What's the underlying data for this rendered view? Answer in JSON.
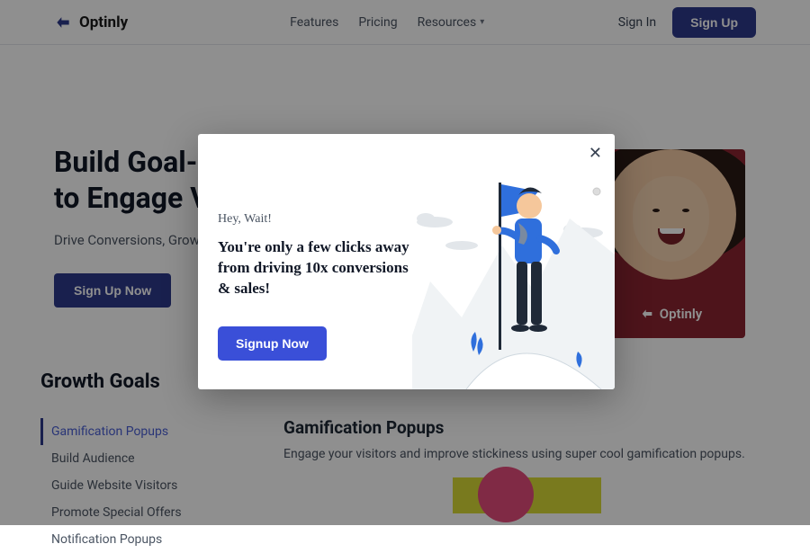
{
  "brand": {
    "name": "Optinly"
  },
  "header": {
    "nav": {
      "features": "Features",
      "pricing": "Pricing",
      "resources": "Resources"
    },
    "signin": "Sign In",
    "signup": "Sign Up"
  },
  "hero": {
    "title_line1": "Build Goal-Ba",
    "title_line2": "to Engage Vis",
    "subtitle": "Drive Conversions, Grow Yo",
    "cta": "Sign Up Now"
  },
  "goals": {
    "title": "Growth Goals",
    "items": [
      "Gamification Popups",
      "Build Audience",
      "Guide Website Visitors",
      "Promote Special Offers",
      "Notification Popups"
    ],
    "panel": {
      "title": "Gamification Popups",
      "desc": "Engage your visitors and improve stickiness using super cool gamification popups."
    }
  },
  "modal": {
    "eyebrow": "Hey, Wait!",
    "headline": "You're only a few clicks away from driving 10x conversions & sales!",
    "cta": "Signup Now"
  }
}
